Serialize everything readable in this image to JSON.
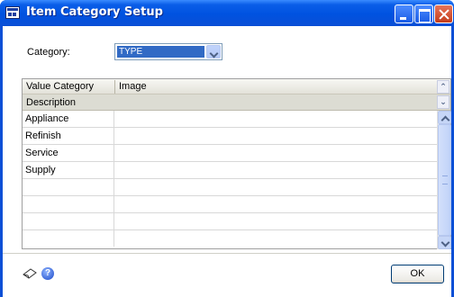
{
  "window": {
    "title": "Item Category Setup"
  },
  "category": {
    "label": "Category:",
    "value": "TYPE"
  },
  "grid": {
    "columns": [
      "Value Category",
      "Image"
    ],
    "subheader": "Description",
    "rows": [
      {
        "value_category": "Appliance",
        "image": ""
      },
      {
        "value_category": "Refinish",
        "image": ""
      },
      {
        "value_category": "Service",
        "image": ""
      },
      {
        "value_category": "Supply",
        "image": ""
      },
      {
        "value_category": "",
        "image": ""
      },
      {
        "value_category": "",
        "image": ""
      },
      {
        "value_category": "",
        "image": ""
      },
      {
        "value_category": "",
        "image": ""
      }
    ]
  },
  "footer": {
    "ok_label": "OK",
    "help_glyph": "?"
  },
  "icons": [
    "window-icon",
    "minimize-icon",
    "maximize-icon",
    "close-icon",
    "dropdown-arrow-icon",
    "expand-up-icon",
    "expand-down-icon",
    "note-icon",
    "help-icon"
  ]
}
